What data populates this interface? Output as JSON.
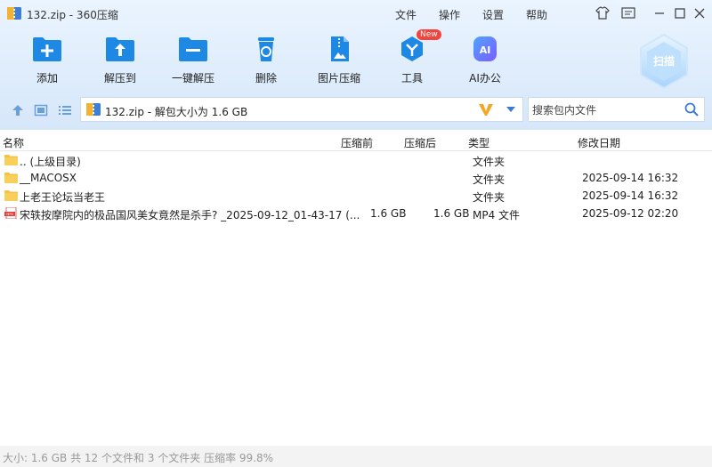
{
  "window": {
    "title": "132.zip - 360压缩"
  },
  "menu": {
    "items": [
      "文件",
      "操作",
      "设置",
      "帮助"
    ]
  },
  "toolbar": {
    "tools": [
      {
        "label": "添加",
        "icon": "add-icon"
      },
      {
        "label": "解压到",
        "icon": "extract-to-icon"
      },
      {
        "label": "一键解压",
        "icon": "one-click-extract-icon"
      },
      {
        "label": "删除",
        "icon": "delete-icon"
      },
      {
        "label": "图片压缩",
        "icon": "image-compress-icon"
      },
      {
        "label": "工具",
        "icon": "tools-icon",
        "badge": "New"
      },
      {
        "label": "AI办公",
        "icon": "ai-office-icon",
        "icon_text": "AI"
      }
    ],
    "scan_label": "扫描"
  },
  "address": {
    "path": "132.zip - 解包大小为 1.6 GB"
  },
  "search": {
    "placeholder": "搜索包内文件"
  },
  "columns": {
    "name": "名称",
    "compressed_before": "压缩前",
    "compressed_after": "压缩后",
    "type": "类型",
    "modified": "修改日期"
  },
  "files": [
    {
      "name": ".. (上级目录)",
      "before": "",
      "after": "",
      "type": "文件夹",
      "date": "",
      "icon": "folder-icon"
    },
    {
      "name": "__MACOSX",
      "before": "",
      "after": "",
      "type": "文件夹",
      "date": "2025-09-14 16:32",
      "icon": "folder-icon"
    },
    {
      "name": "上老王论坛当老王",
      "before": "",
      "after": "",
      "type": "文件夹",
      "date": "2025-09-14 16:32",
      "icon": "folder-icon"
    },
    {
      "name": "宋轶按摩院内的极品国风美女竟然是杀手? _2025-09-12_01-43-17 (...",
      "before": "1.6 GB",
      "after": "1.6 GB",
      "type": "MP4 文件",
      "date": "2025-09-12 02:20",
      "icon": "mp4-file-icon"
    }
  ],
  "status": {
    "text": "大小: 1.6 GB 共 12 个文件和 3 个文件夹 压缩率 99.8%"
  },
  "colors": {
    "accent": "#1e88e5",
    "folder": "#f5c242",
    "badge": "#f0453c",
    "header_bg": "#dcebfb"
  }
}
